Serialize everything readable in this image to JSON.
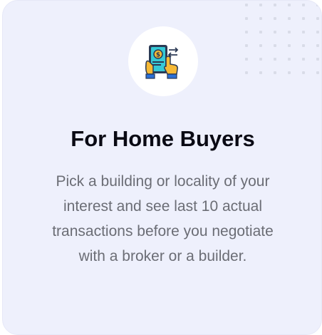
{
  "card": {
    "icon": "phone-payment-transfer-icon",
    "title": "For Home Buyers",
    "description": "Pick a building or locality of your interest and see last 10 actual transactions before you negotiate with a broker or a builder.",
    "colors": {
      "card_background": "#eef0fc",
      "title": "#0a0a14",
      "description": "#6b6d75",
      "icon_circle": "#ffffff",
      "dots": "#d9dce8"
    }
  }
}
